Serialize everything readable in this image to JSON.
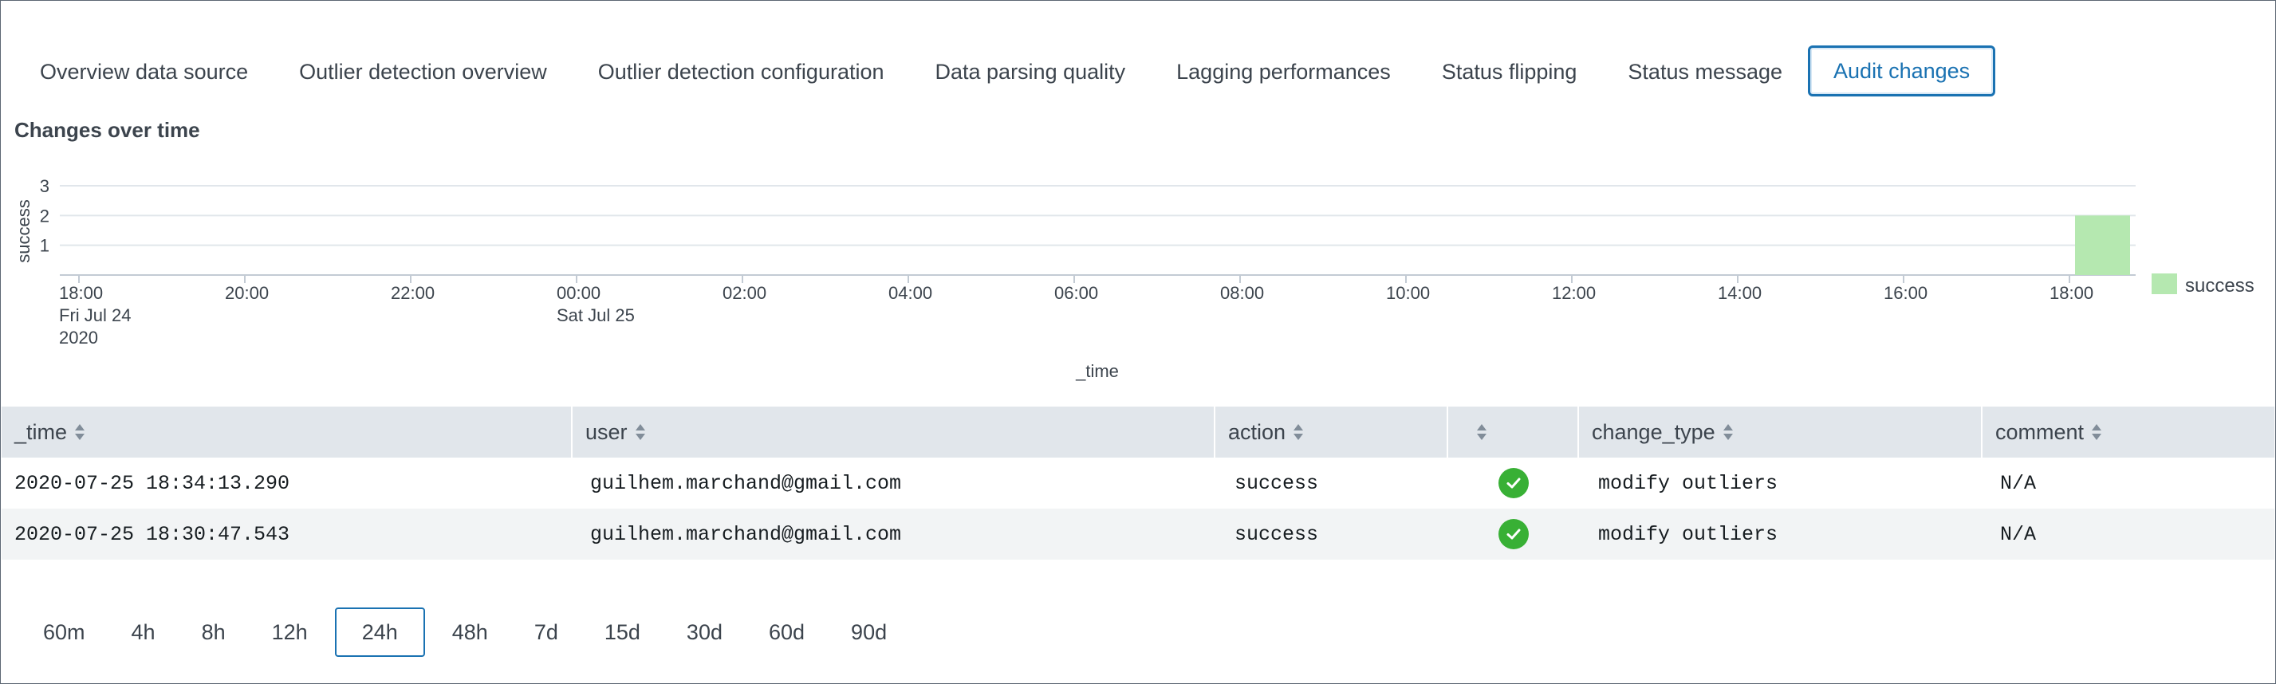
{
  "tabs": [
    {
      "label": "Overview data source",
      "active": false
    },
    {
      "label": "Outlier detection overview",
      "active": false
    },
    {
      "label": "Outlier detection configuration",
      "active": false
    },
    {
      "label": "Data parsing quality",
      "active": false
    },
    {
      "label": "Lagging performances",
      "active": false
    },
    {
      "label": "Status flipping",
      "active": false
    },
    {
      "label": "Status message",
      "active": false
    },
    {
      "label": "Audit changes",
      "active": true
    }
  ],
  "section_title": "Changes over time",
  "chart_data": {
    "type": "bar",
    "ylabel": "success",
    "xlabel": "_time",
    "ylim": [
      0,
      3
    ],
    "yticks": [
      "1",
      "2",
      "3"
    ],
    "xticks": [
      {
        "label": "18:00",
        "sub1": "Fri Jul 24",
        "sub2": "2020"
      },
      {
        "label": "20:00",
        "sub1": "",
        "sub2": ""
      },
      {
        "label": "22:00",
        "sub1": "",
        "sub2": ""
      },
      {
        "label": "00:00",
        "sub1": "Sat Jul 25",
        "sub2": ""
      },
      {
        "label": "02:00",
        "sub1": "",
        "sub2": ""
      },
      {
        "label": "04:00",
        "sub1": "",
        "sub2": ""
      },
      {
        "label": "06:00",
        "sub1": "",
        "sub2": ""
      },
      {
        "label": "08:00",
        "sub1": "",
        "sub2": ""
      },
      {
        "label": "10:00",
        "sub1": "",
        "sub2": ""
      },
      {
        "label": "12:00",
        "sub1": "",
        "sub2": ""
      },
      {
        "label": "14:00",
        "sub1": "",
        "sub2": ""
      },
      {
        "label": "16:00",
        "sub1": "",
        "sub2": ""
      },
      {
        "label": "18:00",
        "sub1": "",
        "sub2": ""
      }
    ],
    "series": [
      {
        "name": "success",
        "color": "#b5e8b0",
        "bars": [
          {
            "start": "2020-07-25 18:00",
            "end": "2020-07-25 19:00",
            "value": 2
          }
        ]
      }
    ],
    "legend_position": "right",
    "grid": true
  },
  "table": {
    "columns": [
      "_time",
      "user",
      "action",
      "",
      "change_type",
      "comment"
    ],
    "rows": [
      {
        "time": "2020-07-25 18:34:13.290",
        "user": "guilhem.marchand@gmail.com",
        "action": "success",
        "status_icon": "check-circle",
        "change_type": "modify outliers",
        "comment": "N/A"
      },
      {
        "time": "2020-07-25 18:30:47.543",
        "user": "guilhem.marchand@gmail.com",
        "action": "success",
        "status_icon": "check-circle",
        "change_type": "modify outliers",
        "comment": "N/A"
      }
    ]
  },
  "time_ranges": {
    "options": [
      "60m",
      "4h",
      "8h",
      "12h",
      "24h",
      "48h",
      "7d",
      "15d",
      "30d",
      "60d",
      "90d"
    ],
    "selected": "24h"
  },
  "colors": {
    "accent": "#1a72b2",
    "success": "#38b035",
    "bar": "#b5e8b0"
  }
}
